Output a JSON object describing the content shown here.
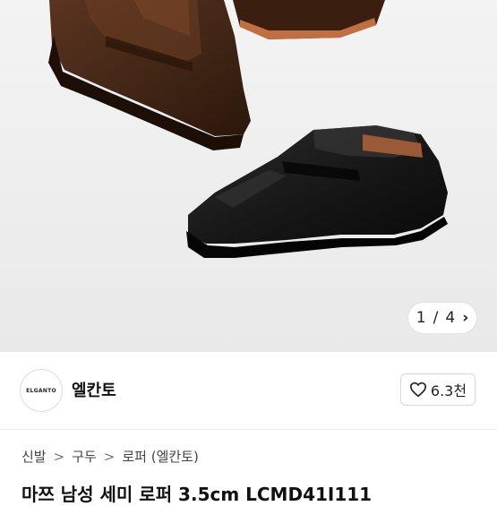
{
  "gallery": {
    "current": "1",
    "separator": "/",
    "total": "4",
    "next_icon": "chevron-right-icon"
  },
  "seller": {
    "logo_text": "ELGANTO",
    "name": "엘칸토",
    "favorite_count": "6.3천",
    "favorite_icon": "heart-outline-icon"
  },
  "breadcrumb": {
    "items": [
      "신발",
      "구두",
      "로퍼 (엘칸토)"
    ],
    "separator": ">"
  },
  "product": {
    "title": "마쯔 남성 세미 로퍼 3.5cm LCMD41I111"
  }
}
